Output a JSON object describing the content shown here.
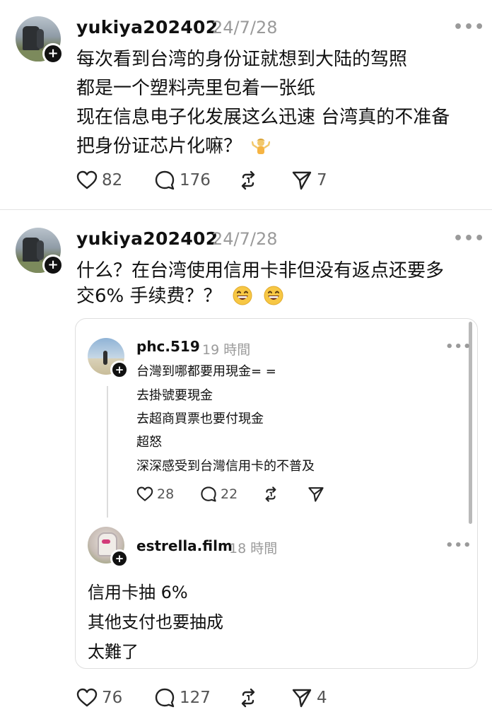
{
  "post1": {
    "username": "yukiya202402",
    "timestamp": "24/7/28",
    "more": "•••",
    "lines": [
      "每次看到台湾的身份证就想到大陆的驾照",
      "都是一个塑料壳里包着一张纸",
      "现在信息电子化发展这么迅速 台湾真的不准备",
      "把身份证芯片化嘛？"
    ],
    "emoji": "shrug",
    "likes": "82",
    "comments": "176",
    "shares": "7"
  },
  "post2": {
    "username": "yukiya202402",
    "timestamp": "24/7/28",
    "more": "•••",
    "lines": [
      "什么？在台湾使用信用卡非但没有返点还要多",
      "交6% 手续费？？"
    ],
    "emoji": "grinning-face",
    "likes": "76",
    "comments": "127",
    "shares": "4",
    "quote": {
      "first": {
        "username": "phc.519",
        "timestamp": "19 時間",
        "more": "•••",
        "lines": [
          "台灣到哪都要用現金= =",
          "去掛號要現金",
          "去超商買票也要付現金",
          "超怒",
          "深深感受到台灣信用卡的不普及"
        ],
        "likes": "28",
        "comments": "22"
      },
      "second": {
        "username": "estrella.film",
        "timestamp": "18 時間",
        "more": "•••",
        "lines": [
          "信用卡抽 6%",
          "其他支付也要抽成",
          "太難了"
        ]
      }
    }
  },
  "icons": {
    "like": "heart-icon",
    "comment": "comment-bubble-icon",
    "repost": "repost-icon",
    "share": "send-icon",
    "follow": "plus-icon"
  }
}
